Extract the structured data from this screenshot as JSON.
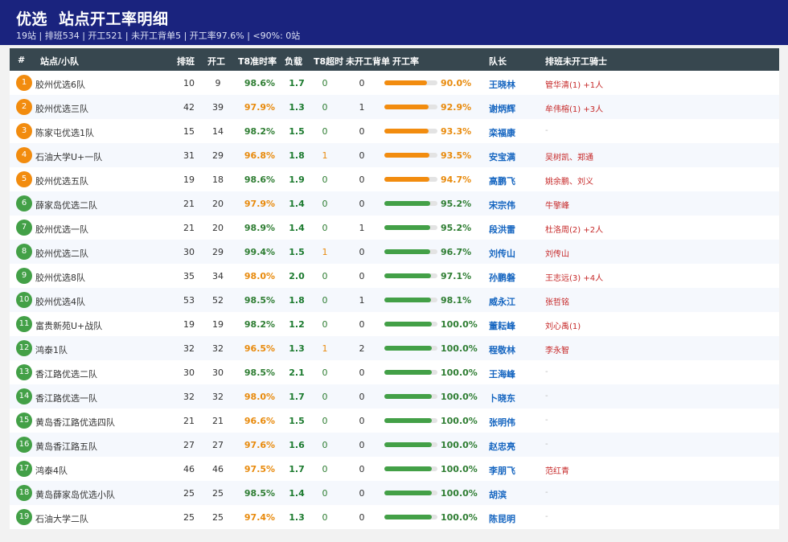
{
  "header": {
    "title_left": "优选",
    "title_right": "站点开工率明细",
    "subtitle": "19站 | 排班534 | 开工521 | 未开工背单5 | 开工率97.6% | <90%: 0站"
  },
  "columns": {
    "rank": "#",
    "name": "站点/小队",
    "scheduled": "排班",
    "started": "开工",
    "t8_ontime": "T8准时率",
    "load": "负载",
    "t8_overtime": "T8超时",
    "unstarted": "未开工背单",
    "rate": "开工率",
    "leader": "队长",
    "riders": "排班未开工骑士"
  },
  "colors": {
    "orange": "#f28c0f",
    "green": "#43a047",
    "header_bg": "#1a237e",
    "thead_bg": "#37474f"
  },
  "rows": [
    {
      "rank": "1",
      "name": "胶州优选6队",
      "scheduled": "10",
      "started": "9",
      "t8": "98.6%",
      "load": "1.7",
      "t8o": "0",
      "un": "0",
      "rate": "90.0%",
      "rate_value": 90.0,
      "leader": "王晓林",
      "riders": "管华清(1) +1人"
    },
    {
      "rank": "2",
      "name": "胶州优选三队",
      "scheduled": "42",
      "started": "39",
      "t8": "97.9%",
      "load": "1.3",
      "t8o": "0",
      "un": "1",
      "rate": "92.9%",
      "rate_value": 92.9,
      "leader": "谢炳辉",
      "riders": "牟伟榕(1) +3人"
    },
    {
      "rank": "3",
      "name": "陈家屯优选1队",
      "scheduled": "15",
      "started": "14",
      "t8": "98.2%",
      "load": "1.5",
      "t8o": "0",
      "un": "0",
      "rate": "93.3%",
      "rate_value": 93.3,
      "leader": "栾福康",
      "riders": "-"
    },
    {
      "rank": "4",
      "name": "石油大学U+一队",
      "scheduled": "31",
      "started": "29",
      "t8": "96.8%",
      "load": "1.8",
      "t8o": "1",
      "un": "0",
      "rate": "93.5%",
      "rate_value": 93.5,
      "leader": "安宝满",
      "riders": "吴树凯、郑通"
    },
    {
      "rank": "5",
      "name": "胶州优选五队",
      "scheduled": "19",
      "started": "18",
      "t8": "98.6%",
      "load": "1.9",
      "t8o": "0",
      "un": "0",
      "rate": "94.7%",
      "rate_value": 94.7,
      "leader": "高鹏飞",
      "riders": "姚余鹏、刘义"
    },
    {
      "rank": "6",
      "name": "薛家岛优选二队",
      "scheduled": "21",
      "started": "20",
      "t8": "97.9%",
      "load": "1.4",
      "t8o": "0",
      "un": "0",
      "rate": "95.2%",
      "rate_value": 95.2,
      "leader": "宋宗伟",
      "riders": "牛擎峰"
    },
    {
      "rank": "7",
      "name": "胶州优选一队",
      "scheduled": "21",
      "started": "20",
      "t8": "98.9%",
      "load": "1.4",
      "t8o": "0",
      "un": "1",
      "rate": "95.2%",
      "rate_value": 95.2,
      "leader": "段洪雷",
      "riders": "杜洛周(2) +2人"
    },
    {
      "rank": "8",
      "name": "胶州优选二队",
      "scheduled": "30",
      "started": "29",
      "t8": "99.4%",
      "load": "1.5",
      "t8o": "1",
      "un": "0",
      "rate": "96.7%",
      "rate_value": 96.7,
      "leader": "刘传山",
      "riders": "刘传山"
    },
    {
      "rank": "9",
      "name": "胶州优选8队",
      "scheduled": "35",
      "started": "34",
      "t8": "98.0%",
      "load": "2.0",
      "t8o": "0",
      "un": "0",
      "rate": "97.1%",
      "rate_value": 97.1,
      "leader": "孙鹏磐",
      "riders": "王志远(3) +4人"
    },
    {
      "rank": "10",
      "name": "胶州优选4队",
      "scheduled": "53",
      "started": "52",
      "t8": "98.5%",
      "load": "1.8",
      "t8o": "0",
      "un": "1",
      "rate": "98.1%",
      "rate_value": 98.1,
      "leader": "威永江",
      "riders": "张哲铭"
    },
    {
      "rank": "11",
      "name": "富贵新苑U+战队",
      "scheduled": "19",
      "started": "19",
      "t8": "98.2%",
      "load": "1.2",
      "t8o": "0",
      "un": "0",
      "rate": "100.0%",
      "rate_value": 100.0,
      "leader": "董耘峰",
      "riders": "刘心禹(1)"
    },
    {
      "rank": "12",
      "name": "鸿泰1队",
      "scheduled": "32",
      "started": "32",
      "t8": "96.5%",
      "load": "1.3",
      "t8o": "1",
      "un": "2",
      "rate": "100.0%",
      "rate_value": 100.0,
      "leader": "程敬林",
      "riders": "李永智"
    },
    {
      "rank": "13",
      "name": "香江路优选二队",
      "scheduled": "30",
      "started": "30",
      "t8": "98.5%",
      "load": "2.1",
      "t8o": "0",
      "un": "0",
      "rate": "100.0%",
      "rate_value": 100.0,
      "leader": "王海峰",
      "riders": "-"
    },
    {
      "rank": "14",
      "name": "香江路优选一队",
      "scheduled": "32",
      "started": "32",
      "t8": "98.0%",
      "load": "1.7",
      "t8o": "0",
      "un": "0",
      "rate": "100.0%",
      "rate_value": 100.0,
      "leader": "卜晓东",
      "riders": "-"
    },
    {
      "rank": "15",
      "name": "黄岛香江路优选四队",
      "scheduled": "21",
      "started": "21",
      "t8": "96.6%",
      "load": "1.5",
      "t8o": "0",
      "un": "0",
      "rate": "100.0%",
      "rate_value": 100.0,
      "leader": "张明伟",
      "riders": "-"
    },
    {
      "rank": "16",
      "name": "黄岛香江路五队",
      "scheduled": "27",
      "started": "27",
      "t8": "97.6%",
      "load": "1.6",
      "t8o": "0",
      "un": "0",
      "rate": "100.0%",
      "rate_value": 100.0,
      "leader": "赵忠亮",
      "riders": "-"
    },
    {
      "rank": "17",
      "name": "鸿泰4队",
      "scheduled": "46",
      "started": "46",
      "t8": "97.5%",
      "load": "1.7",
      "t8o": "0",
      "un": "0",
      "rate": "100.0%",
      "rate_value": 100.0,
      "leader": "李朋飞",
      "riders": "范红青"
    },
    {
      "rank": "18",
      "name": "黄岛薛家岛优选小队",
      "scheduled": "25",
      "started": "25",
      "t8": "98.5%",
      "load": "1.4",
      "t8o": "0",
      "un": "0",
      "rate": "100.0%",
      "rate_value": 100.0,
      "leader": "胡滨",
      "riders": "-"
    },
    {
      "rank": "19",
      "name": "石油大学二队",
      "scheduled": "25",
      "started": "25",
      "t8": "97.4%",
      "load": "1.3",
      "t8o": "0",
      "un": "0",
      "rate": "100.0%",
      "rate_value": 100.0,
      "leader": "陈昆明",
      "riders": "-"
    }
  ]
}
